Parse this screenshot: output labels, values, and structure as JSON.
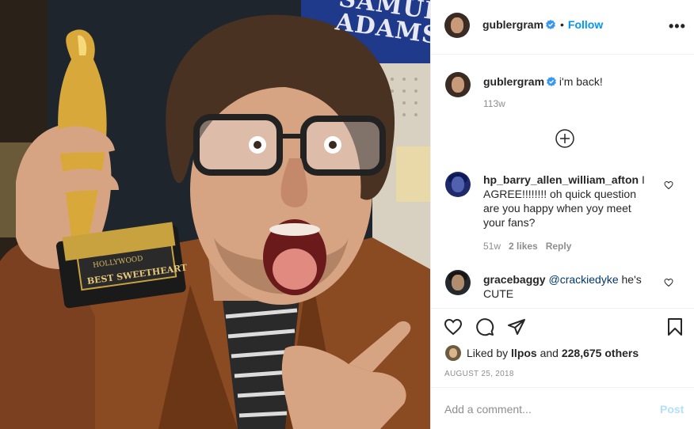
{
  "photo": {
    "sign_text": "SAMUEL\nADAMS",
    "trophy_plate_top": "HOLLYWOOD",
    "trophy_plate_bottom": "BEST SWEETHEART"
  },
  "header": {
    "username": "gublergram",
    "separator": "•",
    "follow_label": "Follow",
    "more_icon": "more-horizontal-icon",
    "more_label": "•••"
  },
  "caption": {
    "username": "gublergram",
    "text": "i'm back!",
    "time": "113w"
  },
  "load_more_icon": "plus-circle-icon",
  "comments": [
    {
      "username": "hp_barry_allen_william_afton",
      "text": " I AGREE!!!!!!!! oh quick question are you happy when yoy meet your fans?",
      "time": "51w",
      "likes": "2 likes",
      "reply": "Reply"
    },
    {
      "username": "gracebaggy",
      "mention": "@crackiedyke",
      "text": " he's CUTE"
    }
  ],
  "actions": {
    "like_icon": "heart-icon",
    "comment_icon": "comment-icon",
    "share_icon": "paper-plane-icon",
    "save_icon": "bookmark-icon",
    "liked_by_prefix": "Liked by ",
    "liked_by_user": "llpos",
    "liked_by_middle": " and ",
    "liked_by_count": "228,675 others",
    "date": "AUGUST 25, 2018"
  },
  "add_comment": {
    "placeholder": "Add a comment...",
    "post_label": "Post"
  },
  "colors": {
    "link": "#0095f6",
    "post_disabled": "#b2dffc",
    "muted": "#8e8e8e",
    "verified": "#3897f0"
  }
}
